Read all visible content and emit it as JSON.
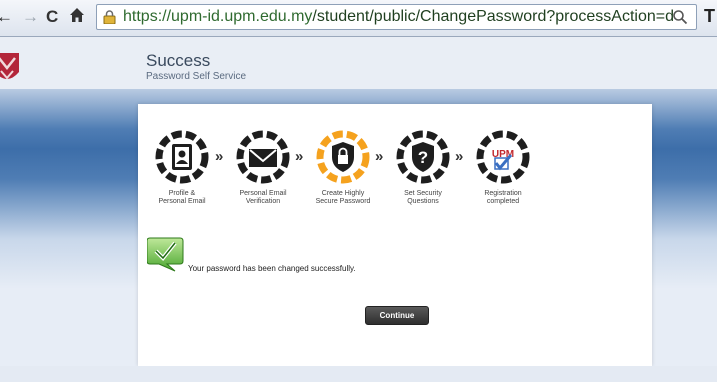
{
  "browser": {
    "url_host": "https://upm-id.upm.edu.my",
    "url_path": "/student/public/ChangePassword?processAction=doChanç",
    "icons": [
      "back-icon",
      "forward-icon",
      "reload-icon",
      "home-icon",
      "lock-icon",
      "search-icon"
    ]
  },
  "header": {
    "title": "Success",
    "subtitle": "Password Self Service"
  },
  "steps": [
    {
      "label": "Profile &\nPersonal Email",
      "icon": "contact-book-icon"
    },
    {
      "label": "Personal Email\nVerification",
      "icon": "envelope-icon"
    },
    {
      "label": "Create Highly\nSecure Password",
      "icon": "shield-lock-icon",
      "active": true
    },
    {
      "label": "Set Security\nQuestions",
      "icon": "question-icon"
    },
    {
      "label": "Registration\ncompleted",
      "icon": "upm-check-icon"
    }
  ],
  "arrows": [
    "»",
    "»",
    "»",
    "»"
  ],
  "message": "Your password has been changed successfully.",
  "continue_label": "Continue",
  "colors": {
    "accent_orange": "#f5a21e",
    "step_dark": "#1e1e1e",
    "success_green": "#4aa62f",
    "band_blue": "#3d6ea9"
  }
}
